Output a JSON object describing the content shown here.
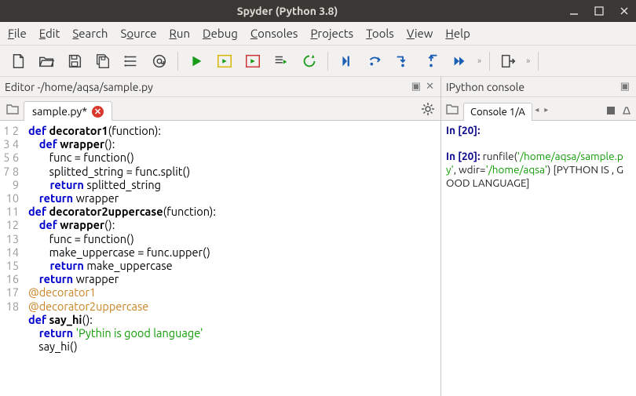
{
  "window": {
    "title": "Spyder (Python 3.8)"
  },
  "menu": {
    "items": [
      {
        "key": "F",
        "rest": "ile"
      },
      {
        "key": "E",
        "rest": "dit"
      },
      {
        "key": "S",
        "rest": "earch"
      },
      {
        "key": "S",
        "rest": "o",
        "rest2": "urce",
        "pre": "S",
        "mid": "o",
        "keypos": 1
      },
      {
        "key": "R",
        "rest": "un"
      },
      {
        "key": "D",
        "rest": "ebug"
      },
      {
        "key": "C",
        "rest": "onsoles"
      },
      {
        "key": "P",
        "rest": "rojects"
      },
      {
        "key": "T",
        "rest": "ools"
      },
      {
        "key": "V",
        "rest": "iew"
      },
      {
        "key": "H",
        "rest": "elp"
      }
    ],
    "labels": [
      "File",
      "Edit",
      "Search",
      "Source",
      "Run",
      "Debug",
      "Consoles",
      "Projects",
      "Tools",
      "View",
      "Help"
    ]
  },
  "toolbar": {
    "icons": [
      "new-file",
      "open-file",
      "save",
      "save-all",
      "list",
      "at-symbol",
      "sep",
      "run",
      "run-cell",
      "run-cell-advance",
      "run-selection",
      "rerun",
      "sep",
      "debug",
      "step-over",
      "step-into",
      "step-out",
      "continue",
      "chev",
      "sep",
      "exit",
      "chev",
      "sep"
    ]
  },
  "editor": {
    "title_prefix": "Editor - ",
    "path": "/home/aqsa/sample.py",
    "tab_label": "sample.py*",
    "gutter": [
      "1",
      "2",
      "3",
      "4",
      "5",
      "6",
      "7",
      "8",
      "9",
      "10",
      "11",
      "12",
      "13",
      "14",
      "15",
      "16",
      "17",
      "18"
    ],
    "code": {
      "l1_def": "def ",
      "l1_fn": "decorator1",
      "l1_rest": "(function):",
      "l2_def": "    def ",
      "l2_fn": "wrapper",
      "l2_rest": "():",
      "l3": "        func = function()",
      "l4": "        splitted_string = func.split()",
      "l5_ret": "        return ",
      "l5_rest": "splitted_string",
      "l6_ret": "    return ",
      "l6_rest": "wrapper",
      "l7_def": "def ",
      "l7_fn": "decorator2uppercase",
      "l7_rest": "(function):",
      "l8_def": "    def ",
      "l8_fn": "wrapper",
      "l8_rest": "():",
      "l9": "        func = function()",
      "l10": "        make_uppercase = func.upper()",
      "l11_ret": "        return ",
      "l11_rest": "make_uppercase",
      "l12_ret": "    return ",
      "l12_rest": "wrapper",
      "l13": "@decorator1",
      "l14": "@decorator2uppercase",
      "l15_def": "def ",
      "l15_fn": "say_hi",
      "l15_rest": "():",
      "l16_ret": "    return ",
      "l16_str": "'Pythin is good language'",
      "l17": "    say_hi()",
      "l18": ""
    }
  },
  "console": {
    "title": "IPython console",
    "tab_label": "Console 1/A",
    "lines": {
      "p1_label": "In [",
      "p1_num": "20",
      "p1_close": "]:",
      "p2_label": "In [",
      "p2_num": "20",
      "p2_close": "]: ",
      "p2_cmd": "runfile(",
      "p2_path": "'/home/aqsa/sample.py'",
      "p2_mid": ", wdir=",
      "p2_wdir": "'/home/aqsa'",
      "p2_end": ") [PYTHON IS , GOOD LANGUAGE]"
    }
  }
}
